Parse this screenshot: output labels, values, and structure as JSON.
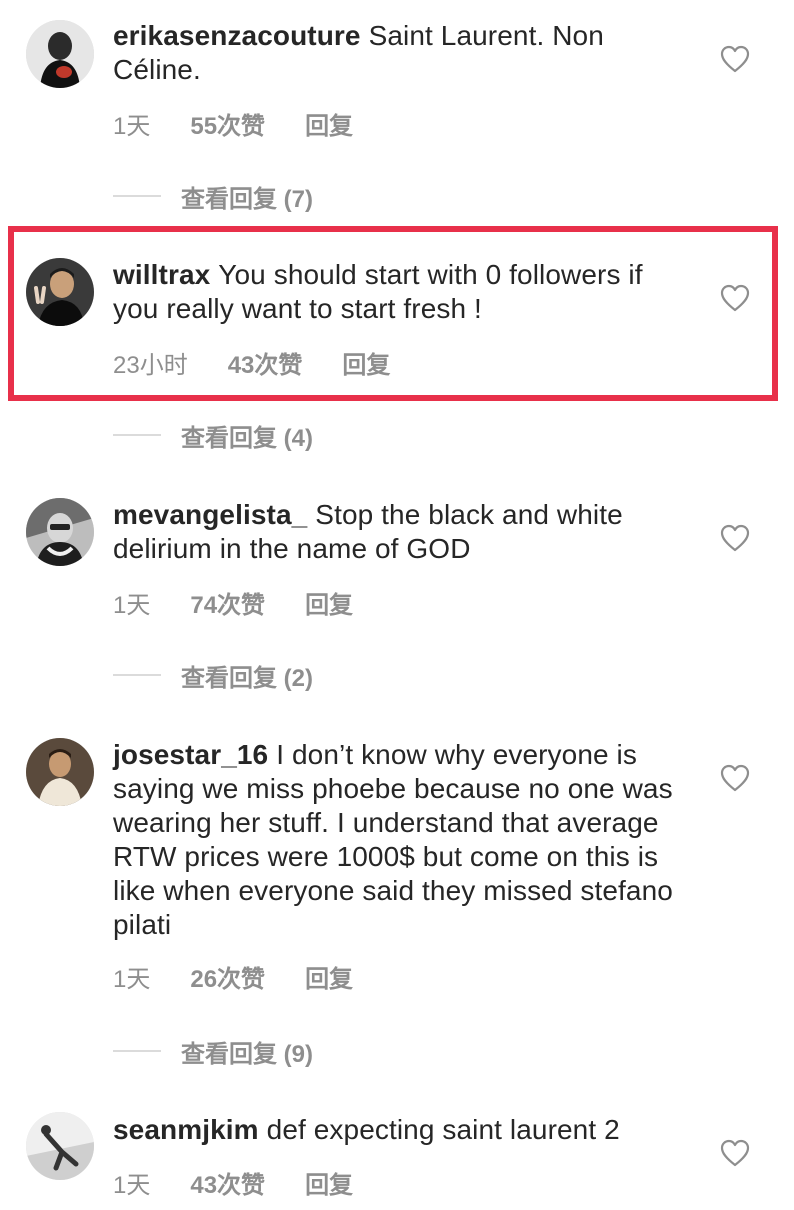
{
  "comments": [
    {
      "username": "erikasenzacouture",
      "text": "Saint Laurent. Non Céline.",
      "time": "1天",
      "likes": "55次赞",
      "reply": "回复",
      "view_replies": "查看回复 (7)"
    },
    {
      "username": "willtrax",
      "text": "You should start with 0 followers if you really want to start fresh !",
      "time": "23小时",
      "likes": "43次赞",
      "reply": "回复",
      "view_replies": "查看回复 (4)"
    },
    {
      "username": "mevangelista_",
      "text": "Stop the black and white delirium in the name of GOD",
      "time": "1天",
      "likes": "74次赞",
      "reply": "回复",
      "view_replies": "查看回复 (2)"
    },
    {
      "username": "josestar_16",
      "text": "I don’t know why everyone is saying we miss phoebe because no one was wearing her stuff. I understand that average RTW prices were 1000$ but come on this is like when everyone said they missed stefano pilati",
      "time": "1天",
      "likes": "26次赞",
      "reply": "回复",
      "view_replies": "查看回复 (9)"
    },
    {
      "username": "seanmjkim",
      "text": "def expecting saint laurent 2",
      "time": "1天",
      "likes": "43次赞",
      "reply": "回复"
    }
  ],
  "colors": {
    "text": "#262626",
    "meta": "#8e8e8e",
    "highlight_border": "#e8304a"
  },
  "icons": [
    "avatar",
    "heart-outline-icon"
  ]
}
